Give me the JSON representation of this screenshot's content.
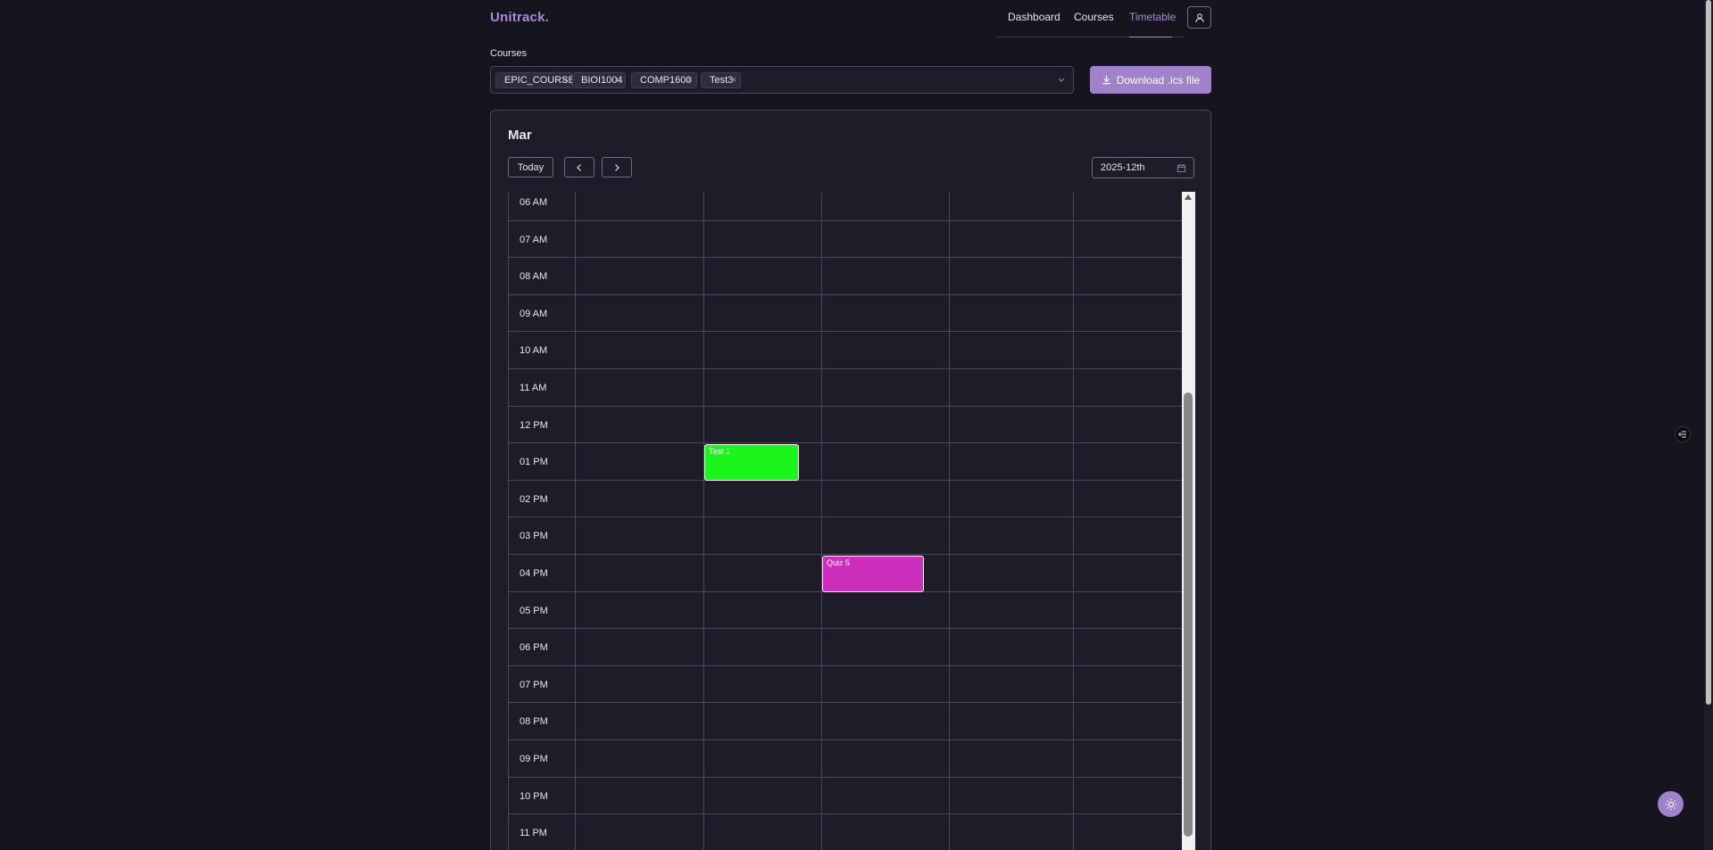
{
  "brand": "Unitrack.",
  "nav": {
    "dashboard": "Dashboard",
    "courses": "Courses",
    "timetable": "Timetable",
    "active": "Timetable"
  },
  "courses": {
    "label": "Courses",
    "chips": [
      "EPIC_COURSE",
      "BIOI1004",
      "COMP1600",
      "Test3"
    ]
  },
  "download": {
    "label": "Download .ics file"
  },
  "calendar": {
    "month": "Mar",
    "today_label": "Today",
    "date_value": "2025-12th",
    "hours": [
      "06 AM",
      "07 AM",
      "08 AM",
      "09 AM",
      "10 AM",
      "11 AM",
      "12 PM",
      "01 PM",
      "02 PM",
      "03 PM",
      "04 PM",
      "05 PM",
      "06 PM",
      "07 PM",
      "08 PM",
      "09 PM",
      "10 PM",
      "11 PM"
    ],
    "events": [
      {
        "title": "Test 1",
        "color": "#1cf51c",
        "hour": "01 PM",
        "day_column": 2
      },
      {
        "title": "Quiz 5",
        "color": "#cc2fbb",
        "hour": "04 PM",
        "day_column": 3
      }
    ]
  },
  "colors": {
    "accent": "#a98ad6",
    "button": "#9f82c9",
    "background": "#16151f",
    "card": "#1d1c28"
  }
}
